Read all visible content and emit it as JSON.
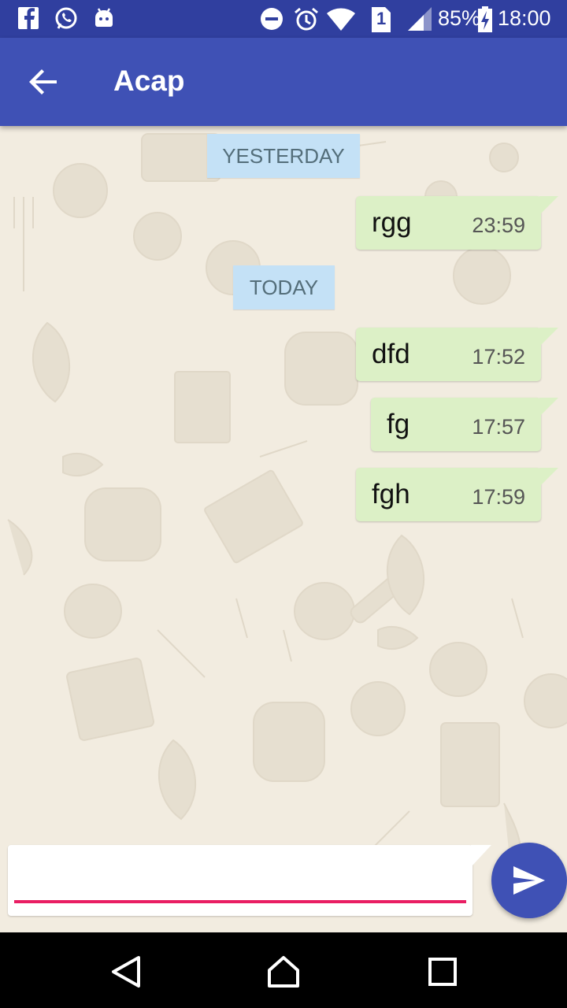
{
  "status_bar": {
    "battery": "85%",
    "time": "18:00",
    "sim": "1",
    "icons": [
      "facebook-icon",
      "whatsapp-icon",
      "android-icon",
      "do-not-disturb-icon",
      "alarm-icon",
      "wifi-icon",
      "sim-icon",
      "signal-icon",
      "battery-charging-icon"
    ]
  },
  "app_bar": {
    "title": "Acap",
    "back_icon": "arrow-back-icon"
  },
  "chat": {
    "sections": [
      {
        "date_label": "YESTERDAY",
        "messages": [
          {
            "text": "rgg",
            "time": "23:59"
          }
        ]
      },
      {
        "date_label": "TODAY",
        "messages": [
          {
            "text": "dfd",
            "time": "17:52"
          },
          {
            "text": "fg",
            "time": "17:57"
          },
          {
            "text": "fgh",
            "time": "17:59"
          }
        ]
      }
    ]
  },
  "composer": {
    "value": "",
    "placeholder": "",
    "send_icon": "send-icon"
  },
  "nav_bar": {
    "icons": [
      "back-triangle-icon",
      "home-icon",
      "recents-icon"
    ]
  },
  "colors": {
    "status_bar": "#303f9f",
    "app_bar": "#3f51b5",
    "chat_background": "#f2ece0",
    "outgoing_bubble": "#dcf0c6",
    "date_chip": "#c4e1f6",
    "input_underline": "#e91e63",
    "send_button": "#3f51b5"
  }
}
